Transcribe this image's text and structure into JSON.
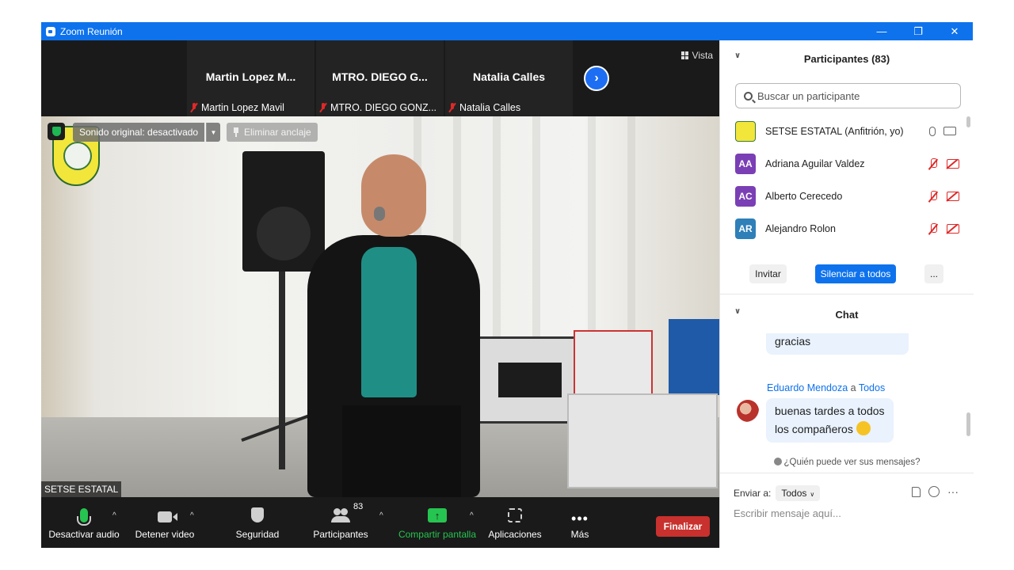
{
  "window": {
    "title": "Zoom Reunión",
    "controls": [
      "—",
      "❐",
      "✕"
    ]
  },
  "stage": {
    "view_label": "Vista",
    "thumbnails": [
      {
        "name": "Martin  Lopez  M...",
        "label": "Martin Lopez Mavil"
      },
      {
        "name": "MTRO.  DIEGO  G...",
        "label": "MTRO. DIEGO GONZ..."
      },
      {
        "name": "Natalia  Calles",
        "label": "Natalia Calles"
      }
    ],
    "next_arrow": "›",
    "sound_label": "Sonido original: desactivado",
    "unpin_label": "Eliminar anclaje",
    "speaker_name": "SETSE ESTATAL"
  },
  "toolbar": {
    "audio_label": "Desactivar audio",
    "video_label": "Detener video",
    "security_label": "Seguridad",
    "participants_label": "Participantes",
    "participants_count": "83",
    "share_label": "Compartir pantalla",
    "share_arrow": "↑",
    "apps_label": "Aplicaciones",
    "more_label": "Más",
    "more_dots": "•••",
    "end_label": "Finalizar",
    "caret": "^",
    "colors": {
      "share_green": "#26c450",
      "end_red": "#c8312d"
    }
  },
  "panel": {
    "participants_title": "Participantes (83)",
    "search_placeholder": "Buscar un participante",
    "participants": [
      {
        "initials": "",
        "name": "SETSE ESTATAL (Anfitrión, yo)",
        "color": "#f2e63a"
      },
      {
        "initials": "AA",
        "name": "Adriana Aguilar Valdez",
        "color": "#7b3fb5"
      },
      {
        "initials": "AC",
        "name": "Alberto Cerecedo",
        "color": "#7b3fb5"
      },
      {
        "initials": "AR",
        "name": "Alejandro Rolon",
        "color": "#2f7fb8"
      }
    ],
    "invite_label": "Invitar",
    "mute_all_label": "Silenciar a todos",
    "more_label": "...",
    "chat_title": "Chat",
    "messages": [
      {
        "text": "gracias"
      },
      {
        "sender": "Eduardo Mendoza",
        "connector": "a",
        "recipient": "Todos",
        "line1": "buenas tardes a todos",
        "line2": "los compañeros"
      }
    ],
    "who_can_see": "¿Quién puede ver sus mensajes?",
    "send_to_label": "Enviar a:",
    "send_to_value": "Todos",
    "more_dots": "···",
    "compose_placeholder": "Escribir mensaje aquí..."
  }
}
